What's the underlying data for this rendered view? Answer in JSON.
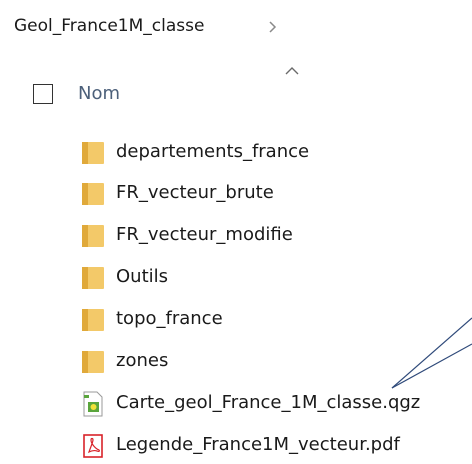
{
  "breadcrumb": {
    "path_label": "Geol_France1M_classe",
    "separator_icon": "chevron-right-icon"
  },
  "header": {
    "name_column_label": "Nom",
    "sort_icon": "sort-ascending-icon"
  },
  "files": [
    {
      "name": "departements_france",
      "type": "folder"
    },
    {
      "name": "FR_vecteur_brute",
      "type": "folder"
    },
    {
      "name": "FR_vecteur_modifie",
      "type": "folder"
    },
    {
      "name": "Outils",
      "type": "folder"
    },
    {
      "name": "topo_france",
      "type": "folder"
    },
    {
      "name": "zones",
      "type": "folder"
    },
    {
      "name": "Carte_geol_France_1M_classe.qgz",
      "type": "qgis-project"
    },
    {
      "name": "Legende_France1M_vecteur.pdf",
      "type": "pdf"
    }
  ],
  "colors": {
    "folder": "#f3c969",
    "folder_dark": "#e0a93a",
    "header_text": "#4c607a",
    "callout_line": "#2f4a7a",
    "pdf_red": "#d8232a",
    "qgis_green": "#5aa53c"
  }
}
